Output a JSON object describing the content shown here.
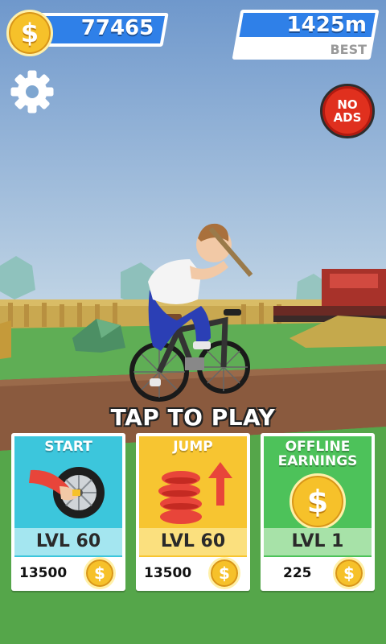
{
  "hud": {
    "coins": "77465",
    "best_distance": "1425m",
    "best_label": "BEST",
    "no_ads_line1": "NO",
    "no_ads_line2": "ADS"
  },
  "prompt": "TAP TO PLAY",
  "cards": [
    {
      "title": "START",
      "level": "LVL 60",
      "cost": "13500"
    },
    {
      "title": "JUMP",
      "level": "LVL 60",
      "cost": "13500"
    },
    {
      "title_line1": "OFFLINE",
      "title_line2": "EARNINGS",
      "level": "LVL 1",
      "cost": "225"
    }
  ],
  "currency_symbol": "$",
  "colors": {
    "hud_blue": "#2f80e8",
    "start_card": "#3cc6dc",
    "jump_card": "#f7c531",
    "offline_card": "#4dc25a",
    "no_ads_red": "#e0301e"
  }
}
